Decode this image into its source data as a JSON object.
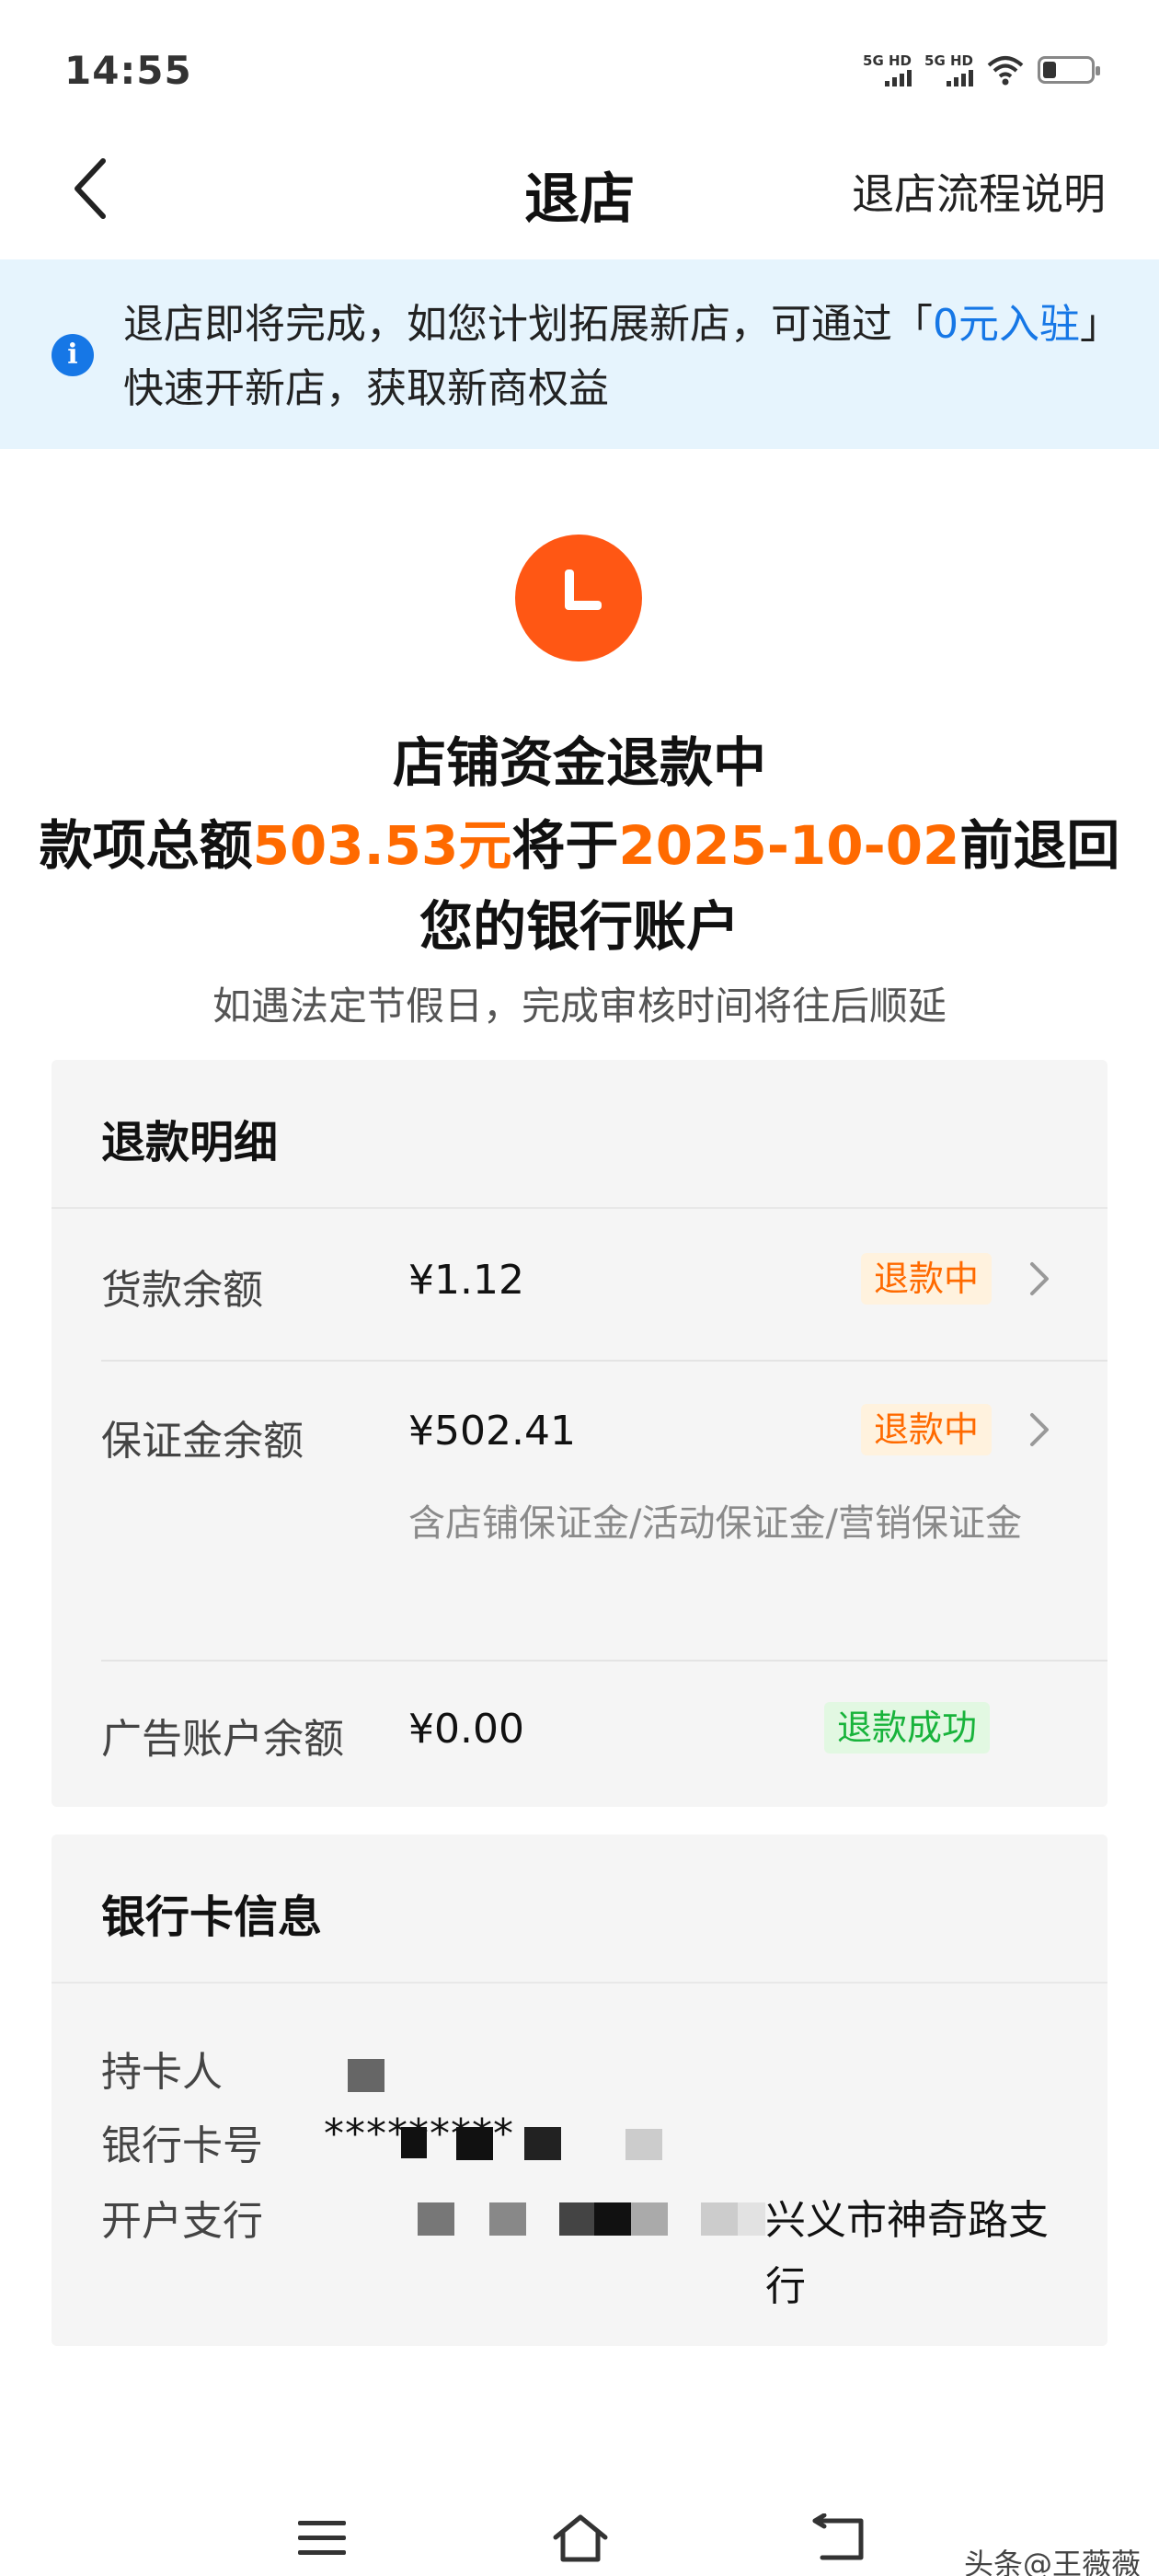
{
  "status_bar": {
    "time": "14:55",
    "signal1_label": "5G HD",
    "signal2_label": "5G HD"
  },
  "nav": {
    "title": "退店",
    "right_link": "退店流程说明",
    "back_icon": "chevron-left-icon"
  },
  "banner": {
    "text_before": "退店即将完成，如您计划拓展新店，可通过「",
    "link": "0元入驻",
    "text_after": "」快速开新店，获取新商权益",
    "icon": "info-icon"
  },
  "refund_status": {
    "icon": "clock-icon",
    "title": "店铺资金退款中",
    "line_prefix": "款项总额",
    "amount": "503.53元",
    "line_mid": "将于",
    "date": "2025-10-02",
    "line_suffix": "前退回",
    "line3": "您的银行账户",
    "note": "如遇法定节假日，完成审核时间将往后顺延"
  },
  "refund_detail": {
    "title": "退款明细",
    "rows": [
      {
        "label": "货款余额",
        "value": "¥1.12",
        "status": "退款中"
      },
      {
        "label": "保证金余额",
        "value": "¥502.41",
        "status": "退款中",
        "sub": "含店铺保证金/活动保证金/营销保证金"
      },
      {
        "label": "广告账户余额",
        "value": "¥0.00",
        "status": "退款成功"
      }
    ]
  },
  "bank_card": {
    "title": "银行卡信息",
    "holder_label": "持卡人",
    "number_label": "银行卡号",
    "number_value": "*********",
    "branch_label": "开户支行",
    "branch_value": "兴义市神奇路支行"
  },
  "bottom_nav": {
    "menu_icon": "menu-icon",
    "home_icon": "home-icon",
    "back_icon": "back-arrow-icon"
  },
  "watermark": "头条@王薇薇",
  "colors": {
    "accent_orange": "#ff6a00",
    "badge_orange": "#ff5714",
    "link_blue": "#1677e6",
    "banner_bg": "#e6f4fd",
    "success_green": "#18b33b"
  }
}
